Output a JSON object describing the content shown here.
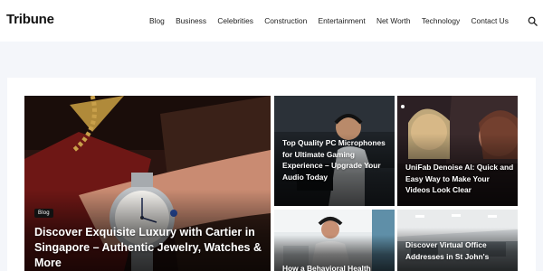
{
  "site": {
    "logo": "Tribune"
  },
  "nav": {
    "items": [
      "Blog",
      "Business",
      "Celebrities",
      "Construction",
      "Entertainment",
      "Net Worth",
      "Technology",
      "Contact Us"
    ]
  },
  "icons": {
    "search": "search-icon"
  },
  "featured": {
    "badge": "Blog",
    "title": "Discover Exquisite Luxury with Cartier in Singapore – Authentic Jewelry, Watches & More"
  },
  "posts": [
    {
      "title": "Top Quality PC Microphones for Ultimate Gaming Experience – Upgrade Your Audio Today"
    },
    {
      "title": "UniFab Denoise AI: Quick and Easy Way to Make Your Videos Look Clear"
    },
    {
      "title": "How a Behavioral Health"
    },
    {
      "title": "Discover Virtual Office Addresses in St John's"
    }
  ],
  "colors": {
    "header_bg": "#ffffff",
    "page_bg": "#f4f6fa",
    "text": "#111111"
  }
}
